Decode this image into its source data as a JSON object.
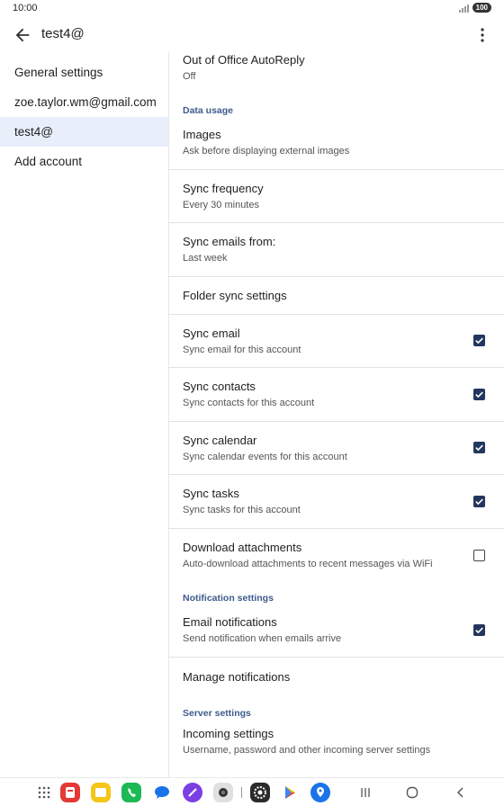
{
  "status_bar": {
    "time": "10:00",
    "battery": "100"
  },
  "app_bar": {
    "title": "test4@",
    "back_icon": "arrow-back-icon",
    "overflow_icon": "more-vert-icon"
  },
  "accounts": [
    {
      "label": "General settings",
      "selected": false
    },
    {
      "label": "zoe.taylor.wm@gmail.com",
      "selected": false
    },
    {
      "label": "test4@",
      "selected": true
    },
    {
      "label": "Add account",
      "selected": false
    }
  ],
  "settings": {
    "out_of_office": {
      "title": "Out of Office AutoReply",
      "summary": "Off"
    },
    "data_usage_header": "Data usage",
    "images": {
      "title": "Images",
      "summary": "Ask before displaying external images"
    },
    "sync_frequency": {
      "title": "Sync frequency",
      "summary": "Every 30 minutes"
    },
    "sync_emails_from": {
      "title": "Sync emails from:",
      "summary": "Last week"
    },
    "folder_sync": {
      "title": "Folder sync settings"
    },
    "sync_email": {
      "title": "Sync email",
      "summary": "Sync email for this account",
      "checked": true
    },
    "sync_contacts": {
      "title": "Sync contacts",
      "summary": "Sync contacts for this account",
      "checked": true
    },
    "sync_calendar": {
      "title": "Sync calendar",
      "summary": "Sync calendar events for this account",
      "checked": true
    },
    "sync_tasks": {
      "title": "Sync tasks",
      "summary": "Sync tasks for this account",
      "checked": true
    },
    "download_attachments": {
      "title": "Download attachments",
      "summary": "Auto-download attachments to recent messages via WiFi",
      "checked": false
    },
    "notification_header": "Notification settings",
    "email_notifications": {
      "title": "Email notifications",
      "summary": "Send notification when emails arrive",
      "checked": true
    },
    "manage_notifications": {
      "title": "Manage notifications"
    },
    "server_header": "Server settings",
    "incoming_settings": {
      "title": "Incoming settings",
      "summary": "Username, password and other incoming server settings"
    }
  },
  "nav_bar": {
    "apps": [
      "app-drawer-icon",
      "flag-app-icon",
      "notes-app-icon",
      "phone-app-icon",
      "messages-app-icon",
      "gallery-app-icon",
      "camera-app-icon",
      "settings-app-icon",
      "play-store-icon",
      "maps-icon"
    ],
    "buttons": [
      "recents-icon",
      "home-icon",
      "back-nav-icon"
    ]
  },
  "colors": {
    "accent": "#23365e",
    "category_text": "#3e5a8c",
    "selected_bg": "#e8effa"
  }
}
